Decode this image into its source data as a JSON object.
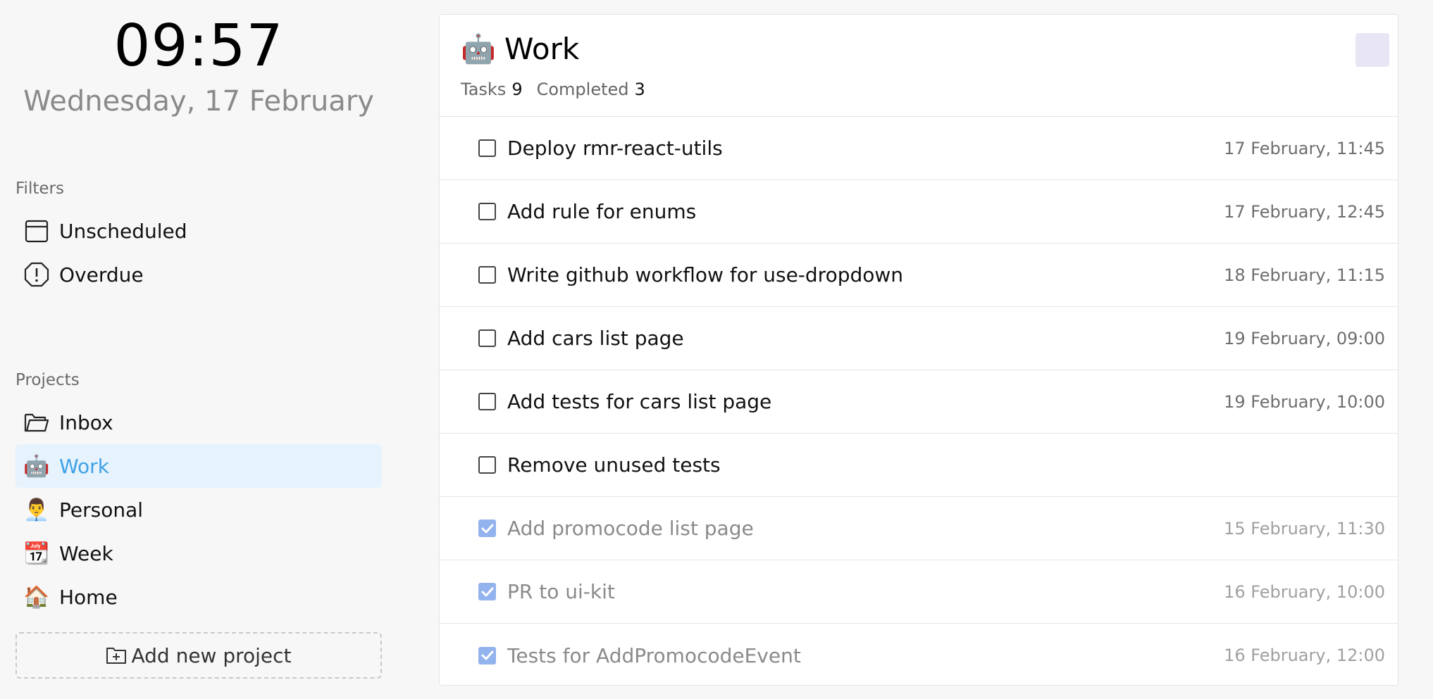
{
  "clock": {
    "time": "09:57",
    "date": "Wednesday, 17 February"
  },
  "filters": {
    "title": "Filters",
    "items": [
      {
        "label": "Unscheduled",
        "icon": "calendar-blank-icon"
      },
      {
        "label": "Overdue",
        "icon": "alert-octagon-icon"
      }
    ]
  },
  "projects": {
    "title": "Projects",
    "items": [
      {
        "label": "Inbox",
        "icon": "folder-icon",
        "active": false
      },
      {
        "label": "Work",
        "icon": "robot-emoji",
        "emoji": "🤖",
        "active": true
      },
      {
        "label": "Personal",
        "icon": "man-emoji",
        "emoji": "👨‍💼",
        "active": false
      },
      {
        "label": "Week",
        "icon": "calendar-emoji",
        "emoji": "📆",
        "active": false
      },
      {
        "label": "Home",
        "icon": "house-emoji",
        "emoji": "🏠",
        "active": false
      }
    ],
    "add_label": "Add new project"
  },
  "header": {
    "emoji": "🤖",
    "title": "Work",
    "tasks_label": "Tasks",
    "tasks_count": "9",
    "completed_label": "Completed",
    "completed_count": "3"
  },
  "tasks": [
    {
      "title": "Deploy rmr-react-utils",
      "due": "17 February, 11:45",
      "done": false
    },
    {
      "title": "Add rule for enums",
      "due": "17 February, 12:45",
      "done": false
    },
    {
      "title": "Write github workflow for use-dropdown",
      "due": "18 February, 11:15",
      "done": false
    },
    {
      "title": "Add cars list page",
      "due": "19 February, 09:00",
      "done": false
    },
    {
      "title": "Add tests for cars list page",
      "due": "19 February, 10:00",
      "done": false
    },
    {
      "title": "Remove unused tests",
      "due": "",
      "done": false
    },
    {
      "title": "Add promocode list page",
      "due": "15 February, 11:30",
      "done": true
    },
    {
      "title": "PR to ui-kit",
      "due": "16 February, 10:00",
      "done": true
    },
    {
      "title": "Tests for AddPromocodeEvent",
      "due": "16 February, 12:00",
      "done": true
    }
  ],
  "colors": {
    "active_bg": "#e6f3fd",
    "active_text": "#3ea1e6",
    "checked": "#93b3ee",
    "swatch": "#e8e6f5"
  }
}
